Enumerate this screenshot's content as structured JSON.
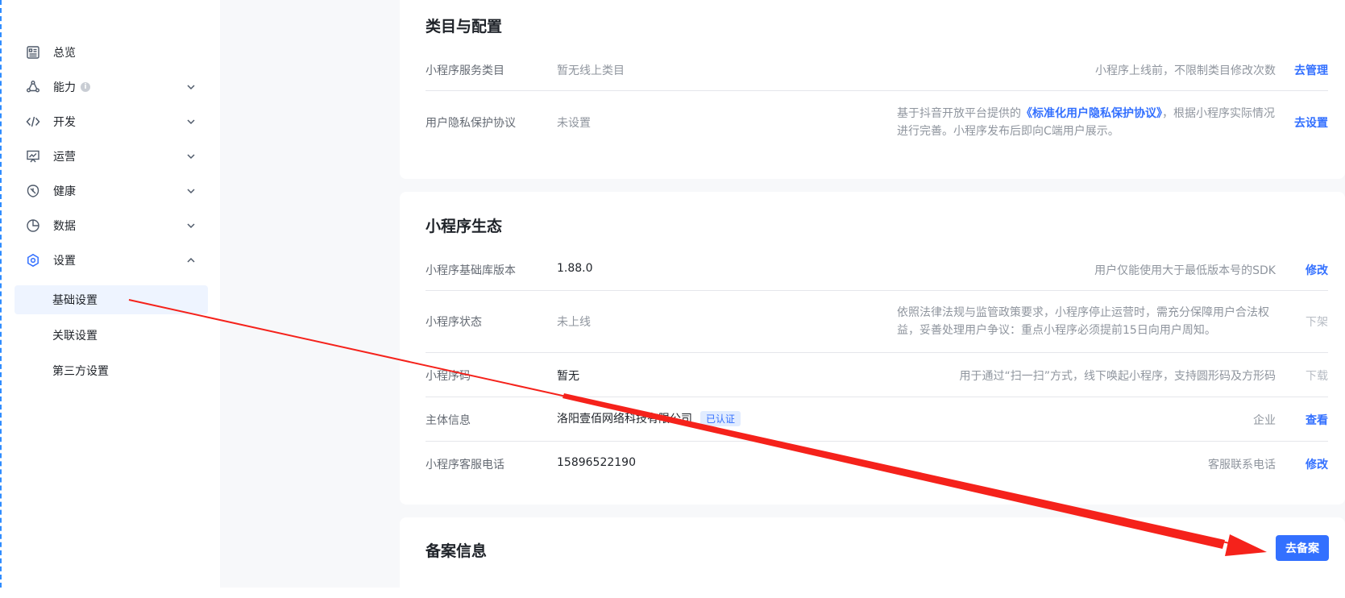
{
  "sidebar": {
    "items": [
      {
        "label": "总览"
      },
      {
        "label": "能力"
      },
      {
        "label": "开发"
      },
      {
        "label": "运营"
      },
      {
        "label": "健康"
      },
      {
        "label": "数据"
      },
      {
        "label": "设置"
      }
    ],
    "sub_items": [
      {
        "label": "基础设置"
      },
      {
        "label": "关联设置"
      },
      {
        "label": "第三方设置"
      }
    ]
  },
  "category_card": {
    "title": "类目与配置",
    "rows": [
      {
        "label": "小程序服务类目",
        "value": "暂无线上类目",
        "desc": "小程序上线前，不限制类目修改次数",
        "action": "去管理"
      },
      {
        "label": "用户隐私保护协议",
        "value": "未设置",
        "desc_pre": "基于抖音开放平台提供的",
        "desc_link": "《标准化用户隐私保护协议》",
        "desc_post": "，根据小程序实际情况进行完善。小程序发布后即向C端用户展示。",
        "action": "去设置"
      }
    ]
  },
  "eco_card": {
    "title": "小程序生态",
    "rows": [
      {
        "label": "小程序基础库版本",
        "value": "1.88.0",
        "desc": "用户仅能使用大于最低版本号的SDK",
        "action": "修改"
      },
      {
        "label": "小程序状态",
        "value": "未上线",
        "desc": "依照法律法规与监管政策要求，小程序停止运营时，需充分保障用户合法权益，妥善处理用户争议：重点小程序必须提前15日向用户周知。",
        "action": "下架"
      },
      {
        "label": "小程序码",
        "value": "暂无",
        "desc": "用于通过“扫一扫”方式，线下唤起小程序，支持圆形码及方形码",
        "action": "下载"
      },
      {
        "label": "主体信息",
        "value": "洛阳壹佰网络科技有限公司",
        "badge": "已认证",
        "desc": "企业",
        "action": "查看"
      },
      {
        "label": "小程序客服电话",
        "value": "15896522190",
        "desc": "客服联系电话",
        "action": "修改"
      }
    ]
  },
  "filing_card": {
    "title": "备案信息",
    "button": "去备案"
  },
  "colors": {
    "accent": "#3370ff",
    "annotation_arrow": "#f5221b"
  }
}
